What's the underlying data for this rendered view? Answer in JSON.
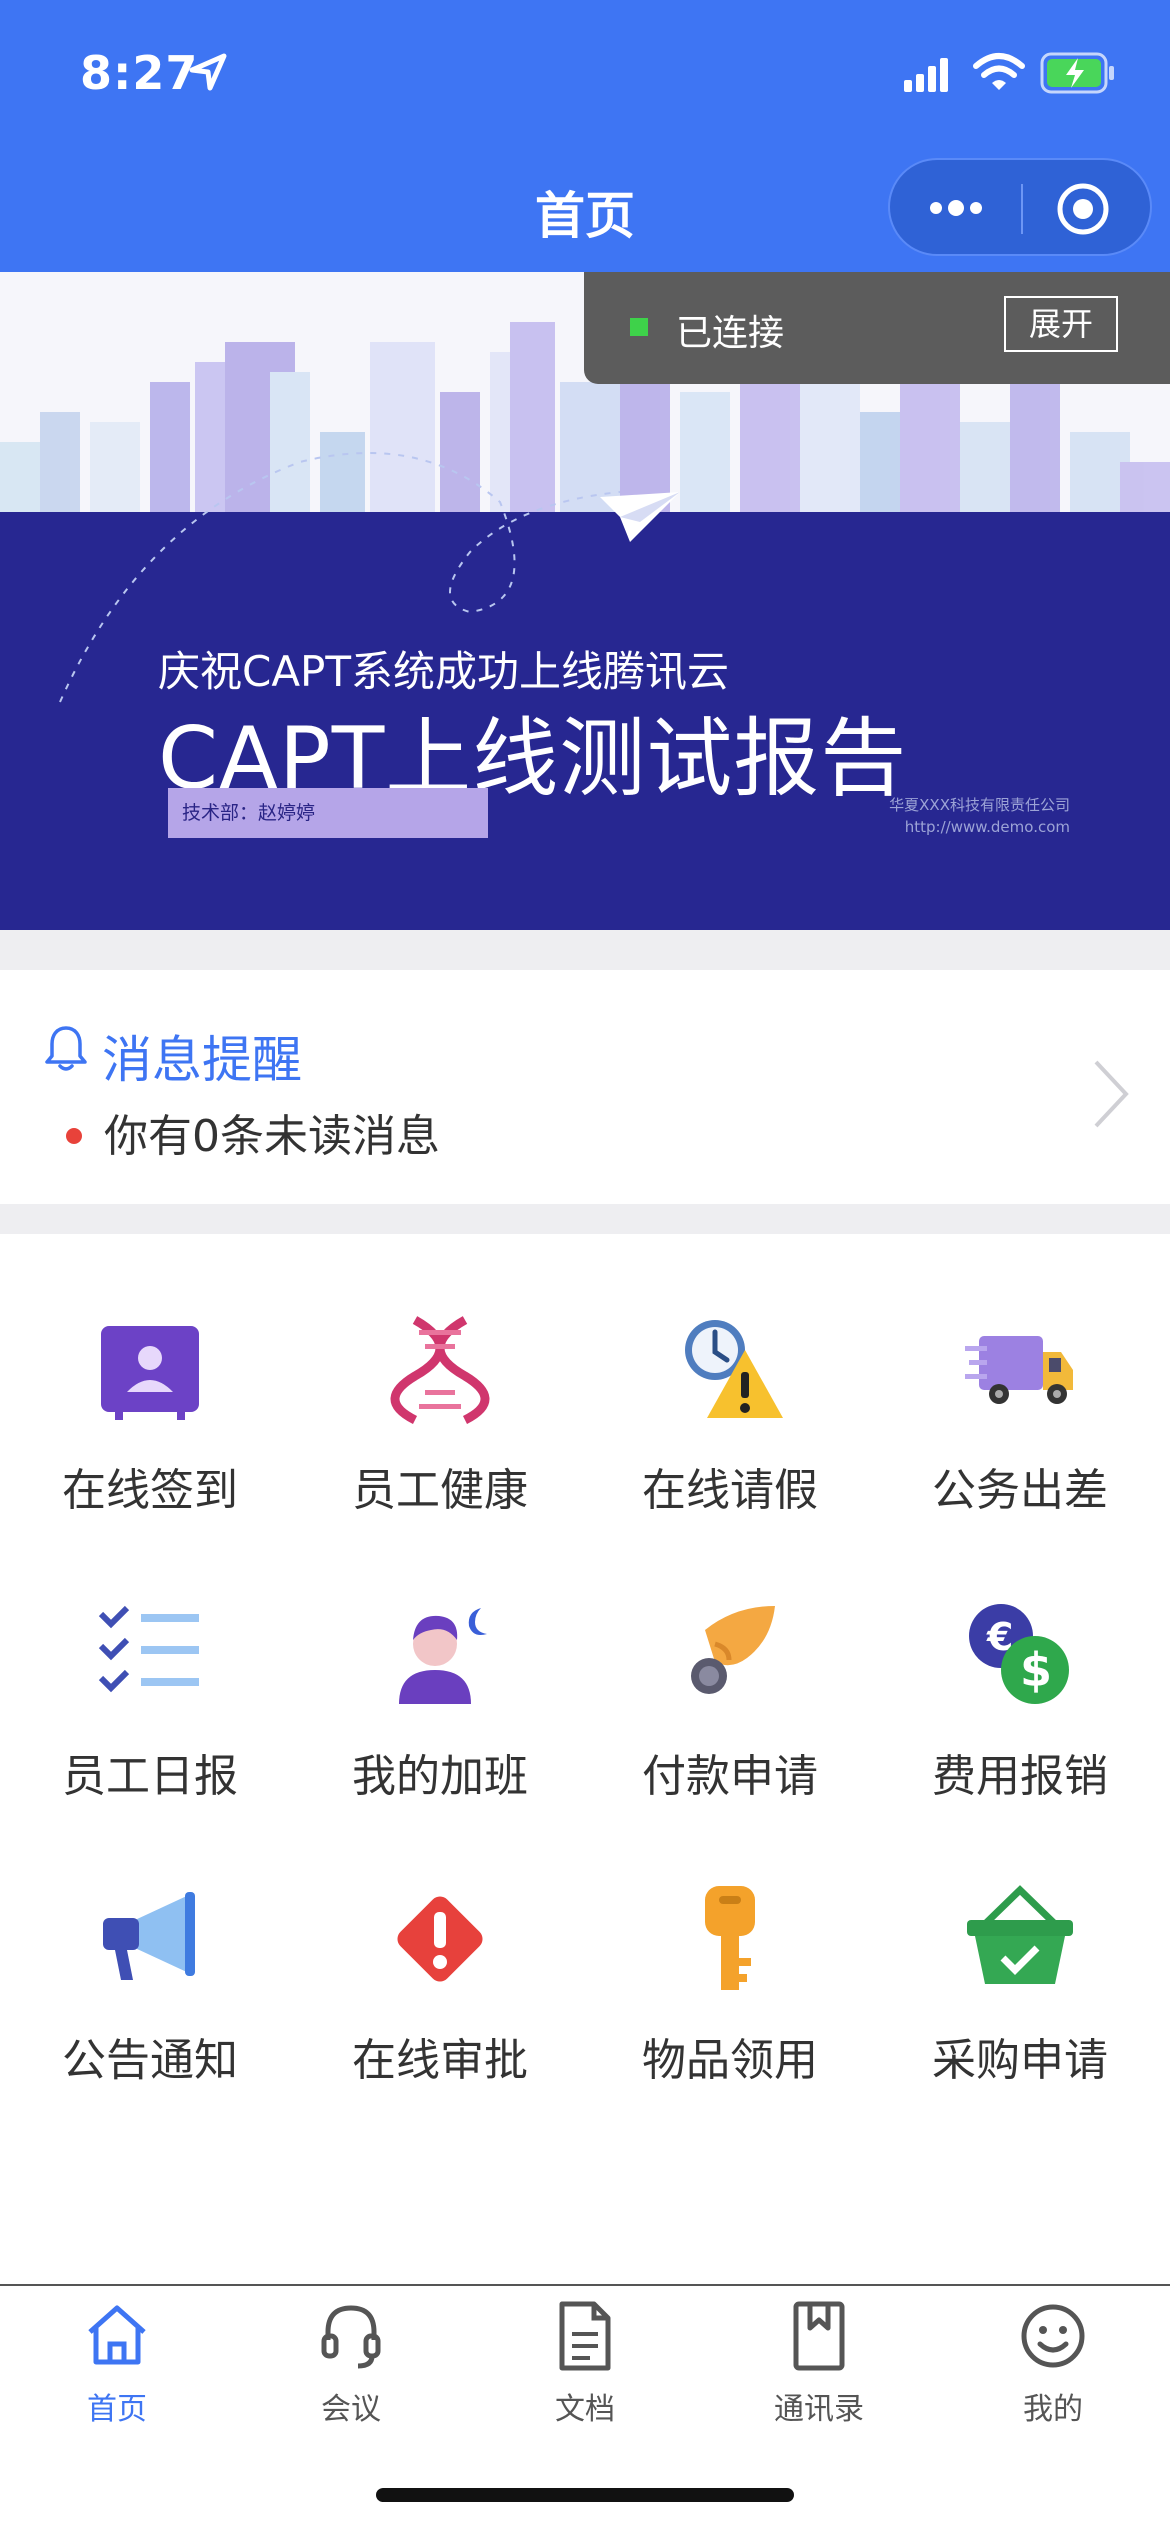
{
  "status_bar": {
    "time": "8:27"
  },
  "nav": {
    "title": "首页"
  },
  "connection": {
    "status": "已连接",
    "expand_label": "展开"
  },
  "banner": {
    "subtitle": "庆祝CAPT系统成功上线腾讯云",
    "title": "CAPT上线测试报告",
    "tag": "技术部：赵婷婷",
    "company": "华夏XXX科技有限责任公司",
    "url": "http://www.demo.com"
  },
  "messages": {
    "title": "消息提醒",
    "text": "你有0条未读消息"
  },
  "grid": {
    "items": [
      {
        "label": "在线签到",
        "icon": "checkin-icon"
      },
      {
        "label": "员工健康",
        "icon": "dna-icon"
      },
      {
        "label": "在线请假",
        "icon": "clock-warning-icon"
      },
      {
        "label": "公务出差",
        "icon": "truck-icon"
      },
      {
        "label": "员工日报",
        "icon": "checklist-icon"
      },
      {
        "label": "我的加班",
        "icon": "person-moon-icon"
      },
      {
        "label": "付款申请",
        "icon": "hand-coin-icon"
      },
      {
        "label": "费用报销",
        "icon": "currency-icon"
      },
      {
        "label": "公告通知",
        "icon": "megaphone-icon"
      },
      {
        "label": "在线审批",
        "icon": "alert-diamond-icon"
      },
      {
        "label": "物品领用",
        "icon": "key-icon"
      },
      {
        "label": "采购申请",
        "icon": "basket-icon"
      }
    ]
  },
  "tabbar": {
    "items": [
      {
        "label": "首页",
        "active": true
      },
      {
        "label": "会议",
        "active": false
      },
      {
        "label": "文档",
        "active": false
      },
      {
        "label": "通讯录",
        "active": false
      },
      {
        "label": "我的",
        "active": false
      }
    ]
  },
  "colors": {
    "primary": "#3e75f3",
    "banner_blue": "#272791",
    "alert_red": "#e8423a"
  }
}
